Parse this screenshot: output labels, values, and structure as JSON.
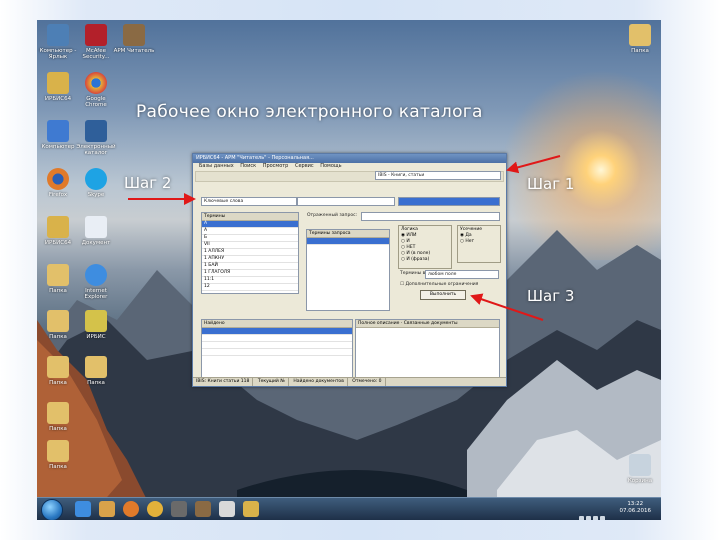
{
  "slide": {
    "title": "Рабочее окно электронного каталога",
    "step1": "Шаг 1",
    "step2": "Шаг 2",
    "step3": "Шаг 3"
  },
  "desktop_icons": [
    {
      "label": "Компьютер - Ярлык",
      "color": "#4d7fb5"
    },
    {
      "label": "McAfee Security...",
      "color": "#b3202a"
    },
    {
      "label": "АРМ Читатель",
      "color": "#8a6a44"
    },
    {
      "label": "ИРБИС64",
      "color": "#d9b24a"
    },
    {
      "label": "Google Chrome",
      "color": "#e8b43a"
    },
    {
      "label": "Компьютер",
      "color": "#3f7ad1"
    },
    {
      "label": "Электронный каталог",
      "color": "#2f5f9a"
    },
    {
      "label": "Firefox",
      "color": "#e07a2a"
    },
    {
      "label": "Skype",
      "color": "#1ea3e4"
    },
    {
      "label": "ИРБИС64",
      "color": "#d9b24a"
    },
    {
      "label": "Документ",
      "color": "#e9eef5"
    },
    {
      "label": "Папка",
      "color": "#e2c06a"
    },
    {
      "label": "Internet Explorer",
      "color": "#3e8de0"
    },
    {
      "label": "Папка",
      "color": "#e2c06a"
    },
    {
      "label": "ИРБИС",
      "color": "#d4c24a"
    },
    {
      "label": "Папка",
      "color": "#e2c06a"
    },
    {
      "label": "Папка",
      "color": "#e2c06a"
    },
    {
      "label": "Папка",
      "color": "#e2c06a"
    },
    {
      "label": "Папка",
      "color": "#e2c06a"
    },
    {
      "label": "Папка",
      "color": "#e2c06a"
    },
    {
      "label": "Папка",
      "color": "#e2c06a"
    },
    {
      "label": "Корзина",
      "color": "#c7d3de"
    }
  ],
  "app": {
    "title": "ИРБИС64 - АРМ \"Читатель\" - Персональная...",
    "menu": [
      "Базы данных",
      "Поиск",
      "Просмотр",
      "Сервис",
      "Помощь"
    ],
    "db_selector": "IBIS - Книги, статьи",
    "search_dictionary": "Ключевые слова",
    "search_mode": "Отраженный запрос:",
    "terms_header": "Термины",
    "terms": [
      "А",
      "А",
      "Б",
      "VII",
      "1 АЛЛЕЯ",
      "1 АПКНУ",
      "1 БАЙ",
      "1 ГЛАГОЛЯ",
      "11:1",
      "12"
    ],
    "query_terms_header": "Термины запроса",
    "logic_group": "Логика",
    "logic_options": [
      "ИЛИ",
      "И",
      "НЕТ",
      "И (в поле)",
      "И (фраза)"
    ],
    "truncation_group": "Усечение",
    "truncation_options": [
      "Да",
      "Нет"
    ],
    "terms_in_label": "Термины в",
    "terms_in_value": "любом поле",
    "extra_limits_label": "Дополнительные ограничения",
    "execute_button": "Выполнить",
    "results_label": "Найдено",
    "lower_tabs": [
      "Полное описание",
      "Связанные документы"
    ],
    "status": [
      "IBIS: Книги статьи 118",
      "Текущий №",
      "Найдено документов",
      "Отмечено: 0"
    ]
  },
  "taskbar": {
    "time": "13:22",
    "date": "07.06.2016"
  }
}
